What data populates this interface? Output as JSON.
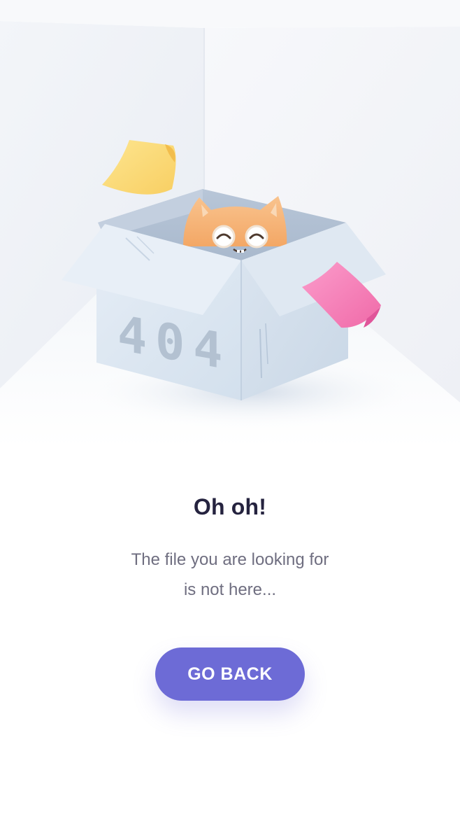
{
  "illustration": {
    "box_label": "404",
    "colors": {
      "wall_left": "#eef1f6",
      "wall_right": "#f4f5f8",
      "box": "#e3ebf4",
      "box_dark": "#cad8e6",
      "cat": "#f6b57a",
      "note_yellow": "#fddc7c",
      "note_pink": "#f782b8"
    }
  },
  "content": {
    "title": "Oh oh!",
    "message_line1": "The file you are looking for",
    "message_line2": "is not here..."
  },
  "actions": {
    "go_back_label": "GO BACK",
    "accent": "#6d6bd6"
  }
}
